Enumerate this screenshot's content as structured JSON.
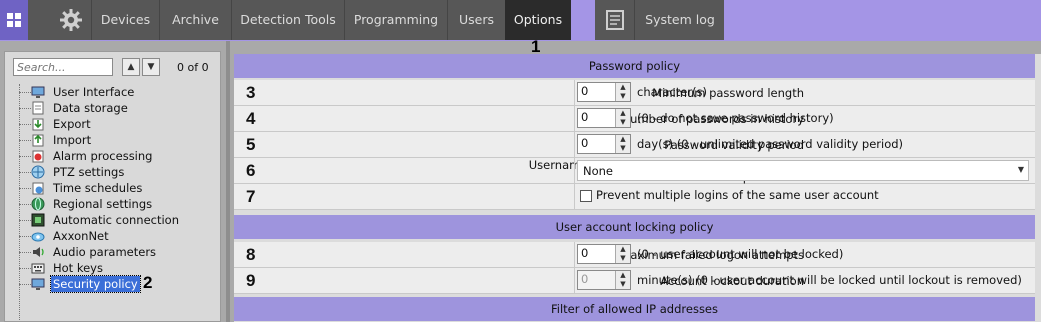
{
  "topbar": {
    "tabs": [
      "Devices",
      "Archive",
      "Detection Tools",
      "Programming",
      "Users",
      "Options"
    ],
    "active_tab": "Options",
    "system_log_label": "System log",
    "colors": {
      "bar": "#575757",
      "active": "#2b2b2b",
      "accent": "#a495e6"
    }
  },
  "callouts": {
    "options": "1",
    "security_policy": "2"
  },
  "sidebar": {
    "search_placeholder": "Search...",
    "up_label": "▲",
    "down_label": "▼",
    "count": "0 of 0",
    "items": [
      {
        "label": "User Interface",
        "icon": "monitor-icon"
      },
      {
        "label": "Data storage",
        "icon": "document-icon"
      },
      {
        "label": "Export",
        "icon": "export-icon"
      },
      {
        "label": "Import",
        "icon": "import-icon"
      },
      {
        "label": "Alarm processing",
        "icon": "alarm-icon"
      },
      {
        "label": "PTZ settings",
        "icon": "ptz-icon"
      },
      {
        "label": "Time schedules",
        "icon": "schedule-icon"
      },
      {
        "label": "Regional settings",
        "icon": "globe-icon"
      },
      {
        "label": "Automatic connection",
        "icon": "connection-icon"
      },
      {
        "label": "AxxonNet",
        "icon": "cloud-icon"
      },
      {
        "label": "Audio parameters",
        "icon": "audio-icon"
      },
      {
        "label": "Hot keys",
        "icon": "keyboard-icon"
      },
      {
        "label": "Security policy",
        "icon": "security-icon"
      }
    ],
    "selected": "Security policy"
  },
  "password_policy": {
    "title": "Password policy",
    "rows": [
      {
        "num": "3",
        "label": "Minimum password length",
        "value": "0",
        "hint": "character(s)"
      },
      {
        "num": "4",
        "label": "Number of passwords in history",
        "value": "0",
        "hint": "(0 - do not save password history)"
      },
      {
        "num": "5",
        "label": "Password validity period",
        "value": "0",
        "hint": "day(s) (0 - unlimited password validity period)"
      }
    ],
    "complexity": {
      "num": "6",
      "label": "Username and password must meet complexity requirements",
      "value": "None"
    },
    "multiple_logins": {
      "num": "7",
      "label": "Prevent multiple logins of the same user account",
      "checked": false
    }
  },
  "locking_policy": {
    "title": "User account locking policy",
    "rows": [
      {
        "num": "8",
        "label": "Maximum failed logon attempts",
        "value": "0",
        "hint": "(0 - user account will not be locked)"
      },
      {
        "num": "9",
        "label": "Account lockout duration",
        "value": "0",
        "hint": "minute(s) (0 - user account will be locked until lockout is removed)",
        "disabled": true
      }
    ]
  },
  "ip_filter": {
    "title": "Filter of allowed IP addresses"
  }
}
